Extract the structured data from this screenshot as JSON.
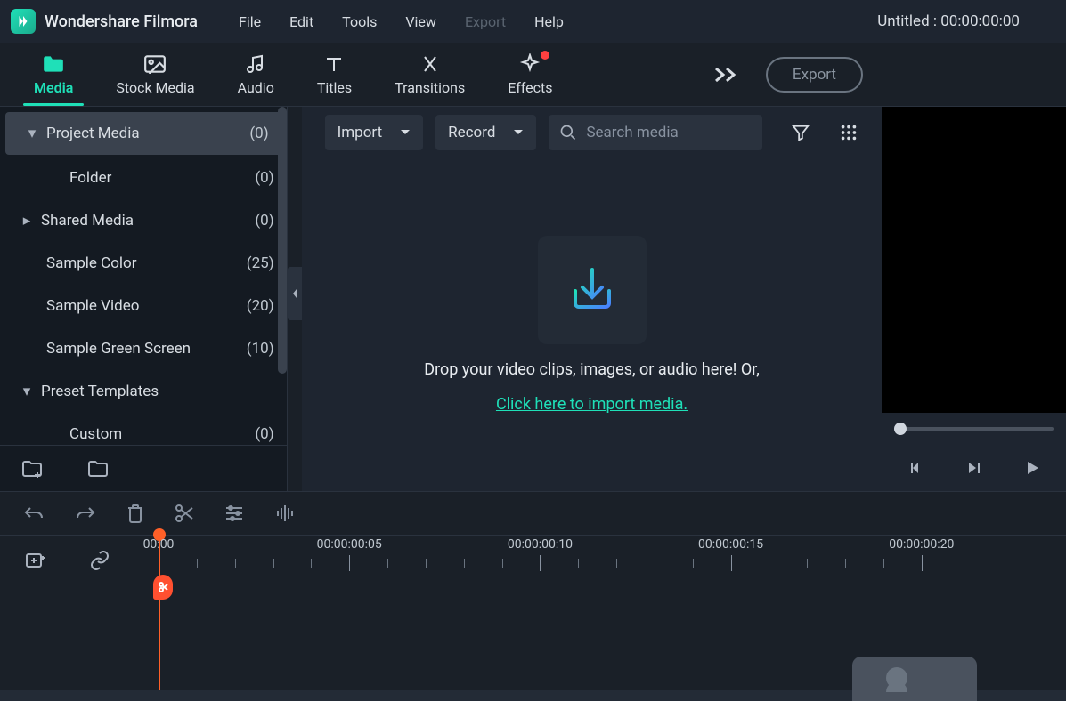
{
  "app": {
    "name": "Wondershare Filmora"
  },
  "menubar": {
    "file": "File",
    "edit": "Edit",
    "tools": "Tools",
    "view": "View",
    "export": "Export",
    "help": "Help"
  },
  "project": {
    "title": "Untitled : 00:00:00:00"
  },
  "tabs": {
    "media": "Media",
    "stock": "Stock Media",
    "audio": "Audio",
    "titles": "Titles",
    "transitions": "Transitions",
    "effects": "Effects"
  },
  "actions": {
    "export": "Export"
  },
  "sidebar": {
    "items": [
      {
        "label": "Project Media",
        "count": "(0)",
        "indent": false,
        "chev": "down"
      },
      {
        "label": "Folder",
        "count": "(0)",
        "indent": true,
        "chev": ""
      },
      {
        "label": "Shared Media",
        "count": "(0)",
        "indent": false,
        "chev": "right"
      },
      {
        "label": "Sample Color",
        "count": "(25)",
        "indent": false,
        "chev": ""
      },
      {
        "label": "Sample Video",
        "count": "(20)",
        "indent": false,
        "chev": ""
      },
      {
        "label": "Sample Green Screen",
        "count": "(10)",
        "indent": false,
        "chev": ""
      },
      {
        "label": "Preset Templates",
        "count": "",
        "indent": false,
        "chev": "down"
      },
      {
        "label": "Custom",
        "count": "(0)",
        "indent": true,
        "chev": ""
      }
    ]
  },
  "media_toolbar": {
    "import": "Import",
    "record": "Record",
    "search_placeholder": "Search media"
  },
  "dropzone": {
    "text": "Drop your video clips, images, or audio here! Or,",
    "link": "Click here to import media."
  },
  "timeline": {
    "ruler_labels": [
      "00:00",
      "00:00:00:05",
      "00:00:00:10",
      "00:00:00:15",
      "00:00:00:20"
    ]
  }
}
